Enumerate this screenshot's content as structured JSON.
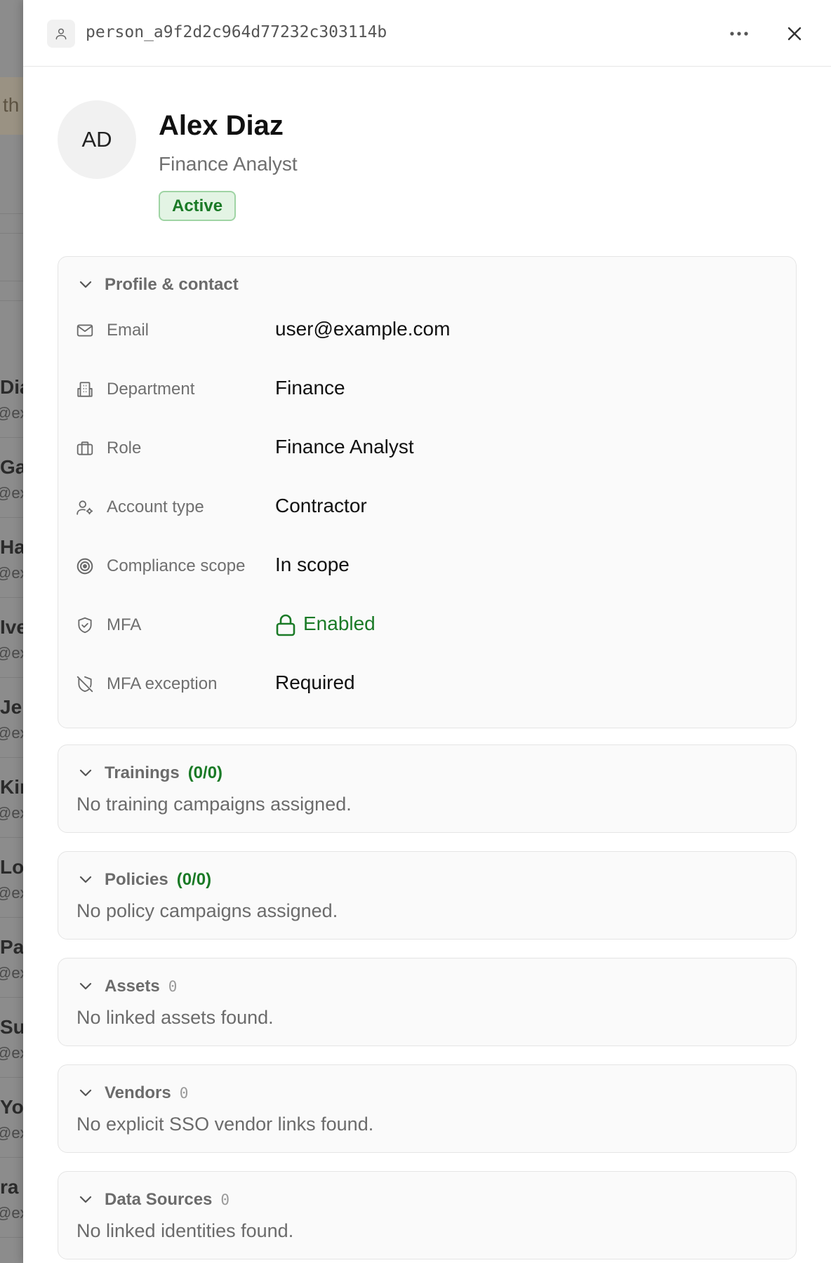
{
  "background_list": {
    "header_fragment": "th",
    "rows": [
      {
        "name": "Dia",
        "email": "@ex"
      },
      {
        "name": "Ga",
        "email": "@ex"
      },
      {
        "name": "Ha",
        "email": "@ex"
      },
      {
        "name": "Ive",
        "email": "@ex"
      },
      {
        "name": "Je",
        "email": "@ex"
      },
      {
        "name": "Kir",
        "email": "@ex"
      },
      {
        "name": "Lo",
        "email": "@ex"
      },
      {
        "name": "Pa",
        "email": "@ex"
      },
      {
        "name": "Su",
        "email": "@ex"
      },
      {
        "name": "Yo",
        "email": "@ex"
      },
      {
        "name": "ra (",
        "email": "@ex"
      }
    ]
  },
  "drawer": {
    "record_id": "person_a9f2d2c964d77232c303114b",
    "more_icon": "more-horizontal-icon",
    "close_icon": "close-icon"
  },
  "person": {
    "initials": "AD",
    "name": "Alex Diaz",
    "title": "Finance Analyst",
    "status": "Active"
  },
  "profile_section": {
    "label": "Profile & contact",
    "fields": [
      {
        "icon": "mail-icon",
        "label": "Email",
        "value": "user@example.com"
      },
      {
        "icon": "building-icon",
        "label": "Department",
        "value": "Finance"
      },
      {
        "icon": "briefcase-icon",
        "label": "Role",
        "value": "Finance Analyst"
      },
      {
        "icon": "user-cog-icon",
        "label": "Account type",
        "value": "Contractor"
      },
      {
        "icon": "target-icon",
        "label": "Compliance scope",
        "value": "In scope"
      },
      {
        "icon": "shield-check-icon",
        "label": "MFA",
        "value": "Enabled"
      },
      {
        "icon": "shield-off-icon",
        "label": "MFA exception",
        "value": "Required"
      }
    ]
  },
  "sections": {
    "trainings": {
      "label": "Trainings",
      "count": "(0/0)",
      "empty": "No training campaigns assigned."
    },
    "policies": {
      "label": "Policies",
      "count": "(0/0)",
      "empty": "No policy campaigns assigned."
    },
    "assets": {
      "label": "Assets",
      "count": "0",
      "empty": "No linked assets found."
    },
    "vendors": {
      "label": "Vendors",
      "count": "0",
      "empty": "No explicit SSO vendor links found."
    },
    "data_sources": {
      "label": "Data Sources",
      "count": "0",
      "empty": "No linked identities found."
    }
  },
  "colors": {
    "accent_green": "#1a7a26",
    "badge_bg": "#e3f4e4",
    "card_bg": "#fafafa"
  }
}
